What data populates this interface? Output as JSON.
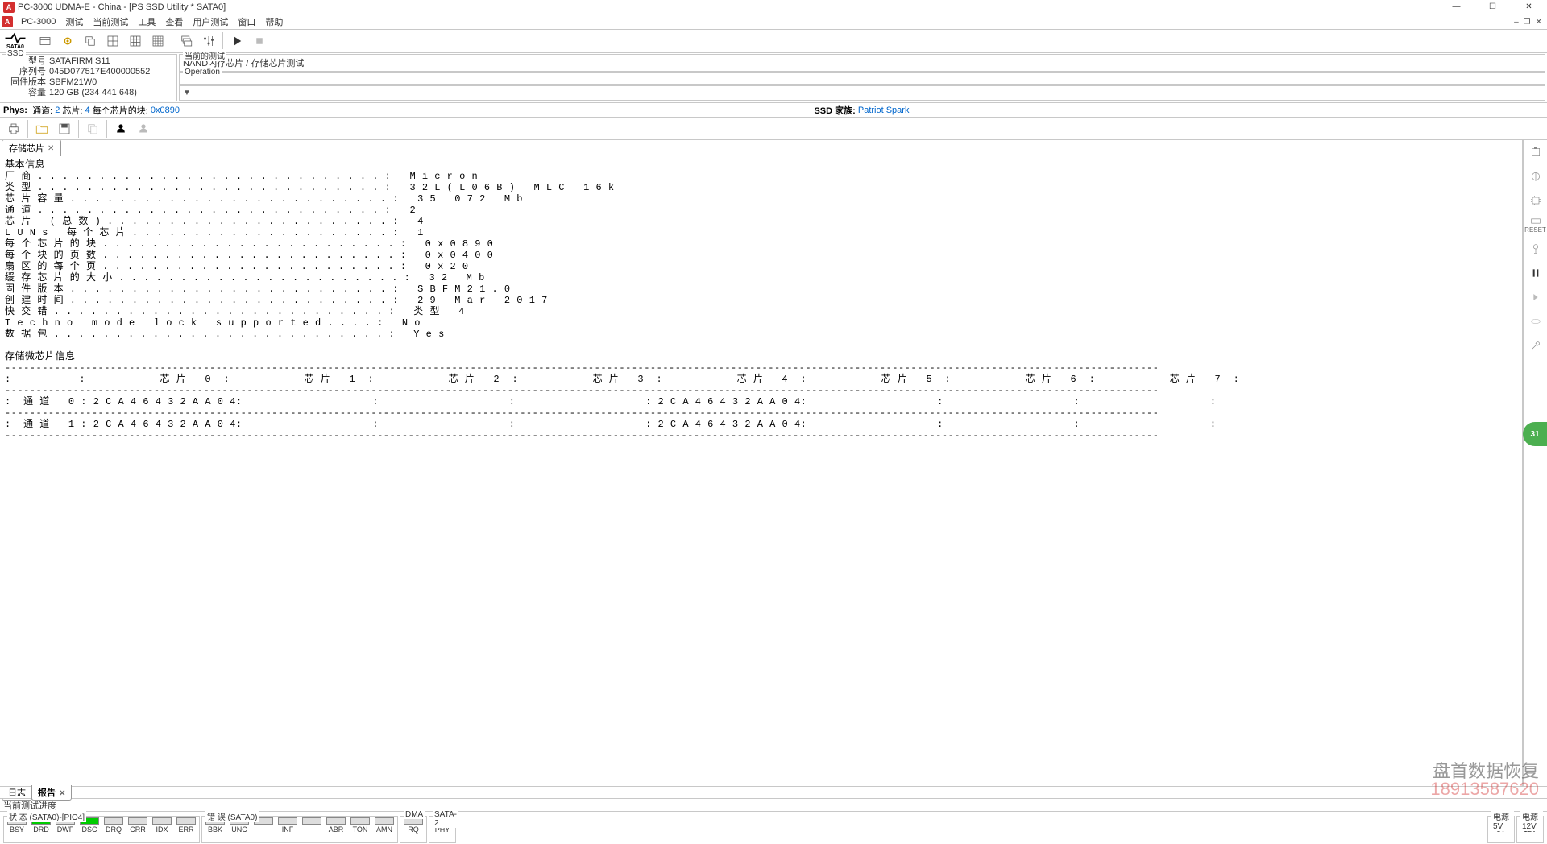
{
  "title": "PC-3000 UDMA-E - China - [PS SSD Utility * SATA0]",
  "menu": [
    "PC-3000",
    "测试",
    "当前测试",
    "工具",
    "查看",
    "用户测试",
    "窗口",
    "帮助"
  ],
  "ssd": {
    "legend": "SSD",
    "model_k": "型号",
    "model_v": "SATAFIRM   S11",
    "serial_k": "序列号",
    "serial_v": "045D077517E400000552",
    "fw_k": "固件版本",
    "fw_v": "SBFM21W0",
    "cap_k": "容量",
    "cap_v": "120 GB (234 441 648)"
  },
  "op": {
    "cur_leg": "当前的测试",
    "cur_text": "NAND闪存芯片 / 存储芯片测试",
    "op_leg": "Operation",
    "dd": "▼"
  },
  "phys": {
    "label": "Phys:",
    "ch_k": "通道:",
    "ch_v": "2",
    "chip_k": "芯片:",
    "chip_v": "4",
    "blk_k": "每个芯片的块:",
    "blk_v": "0x0890",
    "fam_k": "SSD 家族:",
    "fam_v": "Patriot Spark"
  },
  "tab_chip": "存储芯片",
  "report": {
    "h1": "基本信息",
    "lines": [
      {
        "k": "厂商",
        "v": "Micron"
      },
      {
        "k": "类型",
        "v": "32L(L06B) MLC 16k"
      },
      {
        "k": "芯片容量",
        "v": "35 072 Mb"
      },
      {
        "k": "通道",
        "v": "2"
      },
      {
        "k": "芯片 (总数)",
        "v": "4"
      },
      {
        "k": "LUNs 每个芯片",
        "v": "1"
      },
      {
        "k": "每个芯片的块",
        "v": "0x0890"
      },
      {
        "k": "每个块的页数",
        "v": "0x0400"
      },
      {
        "k": "扇区的每个页",
        "v": "0x20"
      },
      {
        "k": "缓存芯片的大小",
        "v": "32 Mb"
      },
      {
        "k": "固件版本",
        "v": "SBFM21.0"
      },
      {
        "k": "创建时间",
        "v": "29 Mar 2017"
      },
      {
        "k": "快交错",
        "v": "类型 4"
      },
      {
        "k": "Techno mode lock supported",
        "v": "No"
      },
      {
        "k": "数据包",
        "v": "Yes"
      }
    ],
    "h2": "存储微芯片信息",
    "cols": [
      "芯片 0",
      "芯片 1",
      "芯片 2",
      "芯片 3",
      "芯片 4",
      "芯片 5",
      "芯片 6",
      "芯片 7"
    ],
    "rows": [
      {
        "ch": "通道 0",
        "c": [
          "2CA46432AA04",
          "",
          "",
          "",
          "2CA46432AA04",
          "",
          "",
          ""
        ]
      },
      {
        "ch": "通道 1",
        "c": [
          "2CA46432AA04",
          "",
          "",
          "",
          "2CA46432AA04",
          "",
          "",
          ""
        ]
      }
    ]
  },
  "btabs": {
    "log": "日志",
    "rpt": "报告"
  },
  "progress": "当前测试进度",
  "status": {
    "g1": "状 态 (SATA0)-[PIO4]",
    "leds1": [
      "BSY",
      "DRD",
      "DWF",
      "DSC",
      "DRQ",
      "CRR",
      "IDX",
      "ERR"
    ],
    "on1": [
      false,
      true,
      false,
      true,
      false,
      false,
      false,
      false
    ],
    "g2": "错 误 (SATA0)",
    "leds2": [
      "BBK",
      "UNC",
      "",
      "INF",
      "",
      "ABR",
      "TON",
      "AMN"
    ],
    "g3": "DMA",
    "leds3": [
      "RQ"
    ],
    "g4": "SATA-2",
    "leds4": [
      "PHY"
    ],
    "on4": [
      true
    ],
    "p5": "电源 5V",
    "p5l": "5V",
    "p12": "电源 12V",
    "p12l": "12V"
  },
  "wm": {
    "a": "盘首数据恢复",
    "b": "18913587620"
  },
  "badge": "31"
}
